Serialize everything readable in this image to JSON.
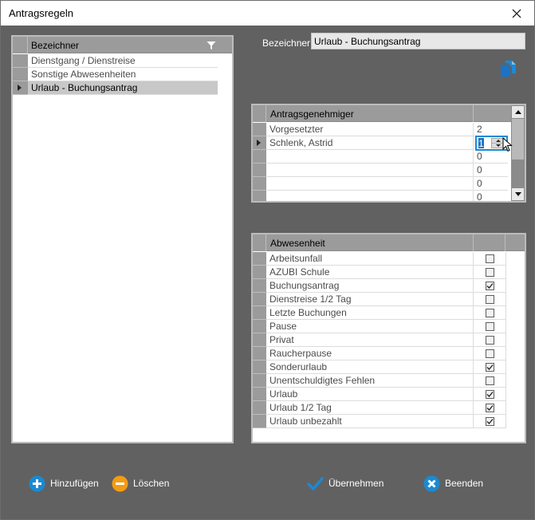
{
  "window": {
    "title": "Antragsregeln"
  },
  "left_grid": {
    "header": "Bezeichner",
    "rows": [
      {
        "label": "Dienstgang / Dienstreise",
        "selected": false
      },
      {
        "label": "Sonstige Abwesenheiten",
        "selected": false
      },
      {
        "label": "Urlaub - Buchungsantrag",
        "selected": true
      }
    ]
  },
  "detail": {
    "bezeichner_label": "Bezeichner",
    "bezeichner_value": "Urlaub - Buchungsantrag"
  },
  "approver_grid": {
    "header": "Antragsgenehmiger",
    "rows": [
      {
        "name": "Vorgesetzter",
        "value": "2"
      },
      {
        "name": "Schlenk, Astrid",
        "value": "1",
        "editing": true
      },
      {
        "name": "",
        "value": "0"
      },
      {
        "name": "",
        "value": "0"
      },
      {
        "name": "",
        "value": "0"
      },
      {
        "name": "",
        "value": "0"
      }
    ]
  },
  "absence_grid": {
    "header": "Abwesenheit",
    "rows": [
      {
        "name": "Arbeitsunfall",
        "checked": false
      },
      {
        "name": "AZUBI Schule",
        "checked": false
      },
      {
        "name": "Buchungsantrag",
        "checked": true
      },
      {
        "name": "Dienstreise 1/2 Tag",
        "checked": false
      },
      {
        "name": "Letzte Buchungen",
        "checked": false
      },
      {
        "name": "Pause",
        "checked": false
      },
      {
        "name": "Privat",
        "checked": false
      },
      {
        "name": "Raucherpause",
        "checked": false
      },
      {
        "name": "Sonderurlaub",
        "checked": true
      },
      {
        "name": "Unentschuldigtes Fehlen",
        "checked": false
      },
      {
        "name": "Urlaub",
        "checked": true
      },
      {
        "name": "Urlaub 1/2 Tag",
        "checked": true
      },
      {
        "name": "Urlaub unbezahlt",
        "checked": true
      }
    ]
  },
  "buttons": {
    "add": "Hinzufügen",
    "delete": "Löschen",
    "apply": "Übernehmen",
    "close": "Beenden"
  },
  "colors": {
    "background": "#616161",
    "accent_blue": "#1a8ad4",
    "delete_orange": "#f39c12",
    "header_gray": "#9b9b9b",
    "selected_row": "#c8c8c8"
  },
  "icons": {
    "close": "close-icon",
    "filter": "filter-icon",
    "copy": "copy-icon",
    "add": "plus-circle-icon",
    "delete": "minus-circle-icon",
    "apply": "checkmark-icon",
    "close_app": "x-circle-icon"
  }
}
